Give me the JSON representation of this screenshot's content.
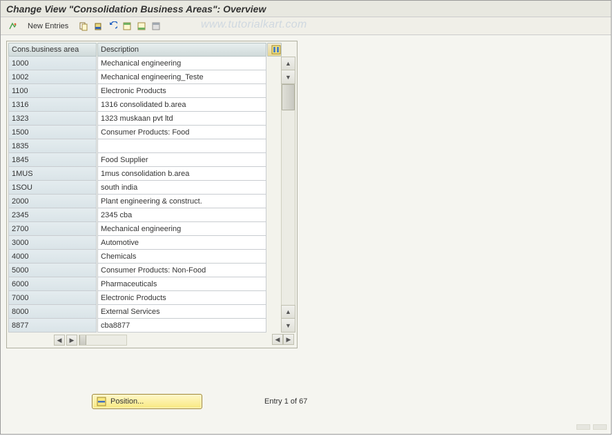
{
  "title": "Change View \"Consolidation Business Areas\": Overview",
  "watermark": "www.tutorialkart.com",
  "toolbar": {
    "new_entries": "New Entries"
  },
  "table": {
    "cols": {
      "area": "Cons.business area",
      "desc": "Description"
    },
    "rows": [
      {
        "area": "1000",
        "desc": "Mechanical engineering"
      },
      {
        "area": "1002",
        "desc": "Mechanical engineering_Teste"
      },
      {
        "area": "1100",
        "desc": "Electronic Products"
      },
      {
        "area": "1316",
        "desc": "1316 consolidated b.area"
      },
      {
        "area": "1323",
        "desc": "1323 muskaan pvt ltd"
      },
      {
        "area": "1500",
        "desc": "Consumer Products: Food"
      },
      {
        "area": "1835",
        "desc": ""
      },
      {
        "area": "1845",
        "desc": "Food Supplier"
      },
      {
        "area": "1MUS",
        "desc": "1mus consolidation b.area"
      },
      {
        "area": "1SOU",
        "desc": "south india"
      },
      {
        "area": "2000",
        "desc": "Plant engineering & construct."
      },
      {
        "area": "2345",
        "desc": "2345 cba"
      },
      {
        "area": "2700",
        "desc": "Mechanical engineering"
      },
      {
        "area": "3000",
        "desc": "Automotive"
      },
      {
        "area": "4000",
        "desc": "Chemicals"
      },
      {
        "area": "5000",
        "desc": "Consumer Products: Non-Food"
      },
      {
        "area": "6000",
        "desc": "Pharmaceuticals"
      },
      {
        "area": "7000",
        "desc": "Electronic Products"
      },
      {
        "area": "8000",
        "desc": "External Services"
      },
      {
        "area": "8877",
        "desc": "cba8877"
      }
    ]
  },
  "position_btn": "Position...",
  "entry_counter": "Entry 1 of 67"
}
